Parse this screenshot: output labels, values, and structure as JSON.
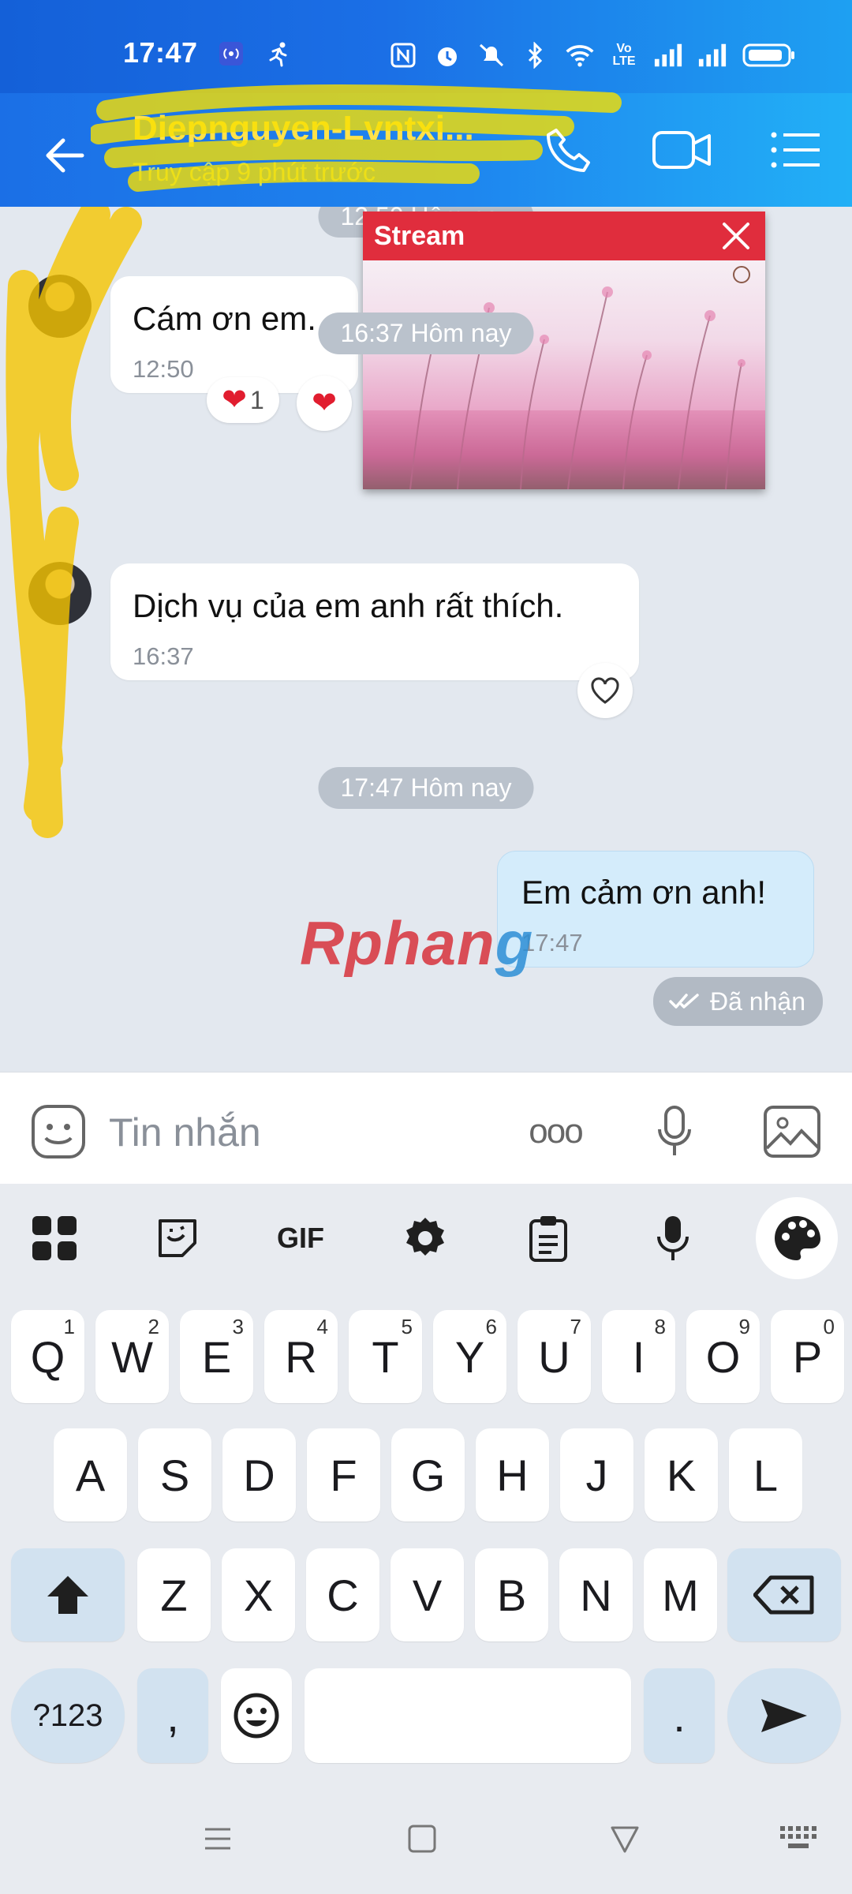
{
  "status_bar": {
    "time": "17:47",
    "icons": [
      "hotspot-icon",
      "running-icon",
      "nfc-icon",
      "alarm-icon",
      "mute-icon",
      "bluetooth-icon",
      "wifi-icon",
      "volte-icon",
      "signal-icon",
      "signal-icon",
      "battery-icon"
    ],
    "volte_label": "Vo LTE"
  },
  "header": {
    "contact_name": "Diepnguyen-Lvntxi...",
    "contact_status": "Truy cập 9 phút trước"
  },
  "chat": {
    "top_partial_time": "12:50 Hôm nay",
    "messages": [
      {
        "text": "Cám ơn em.",
        "time": "12:50",
        "reaction_count": "1"
      },
      {
        "text": "Dịch vụ của em anh rất thích.",
        "time": "16:37"
      },
      {
        "text": "Em cảm ơn anh!",
        "time": "17:47",
        "status": "Đã nhận"
      }
    ],
    "dividers": [
      "16:37 Hôm nay",
      "17:47 Hôm nay"
    ]
  },
  "stream_popup": {
    "title": "Stream"
  },
  "watermark": {
    "left": "Rphan",
    "right": "g"
  },
  "input": {
    "placeholder": "Tin nhắn",
    "more_label": "ooo"
  },
  "keyboard": {
    "toolbar_gif": "GIF",
    "row1": [
      {
        "k": "Q",
        "s": "1"
      },
      {
        "k": "W",
        "s": "2"
      },
      {
        "k": "E",
        "s": "3"
      },
      {
        "k": "R",
        "s": "4"
      },
      {
        "k": "T",
        "s": "5"
      },
      {
        "k": "Y",
        "s": "6"
      },
      {
        "k": "U",
        "s": "7"
      },
      {
        "k": "I",
        "s": "8"
      },
      {
        "k": "O",
        "s": "9"
      },
      {
        "k": "P",
        "s": "0"
      }
    ],
    "row2": [
      "A",
      "S",
      "D",
      "F",
      "G",
      "H",
      "J",
      "K",
      "L"
    ],
    "row3": [
      "Z",
      "X",
      "C",
      "V",
      "B",
      "N",
      "M"
    ],
    "symbols": "?123",
    "comma": ",",
    "period": "."
  }
}
